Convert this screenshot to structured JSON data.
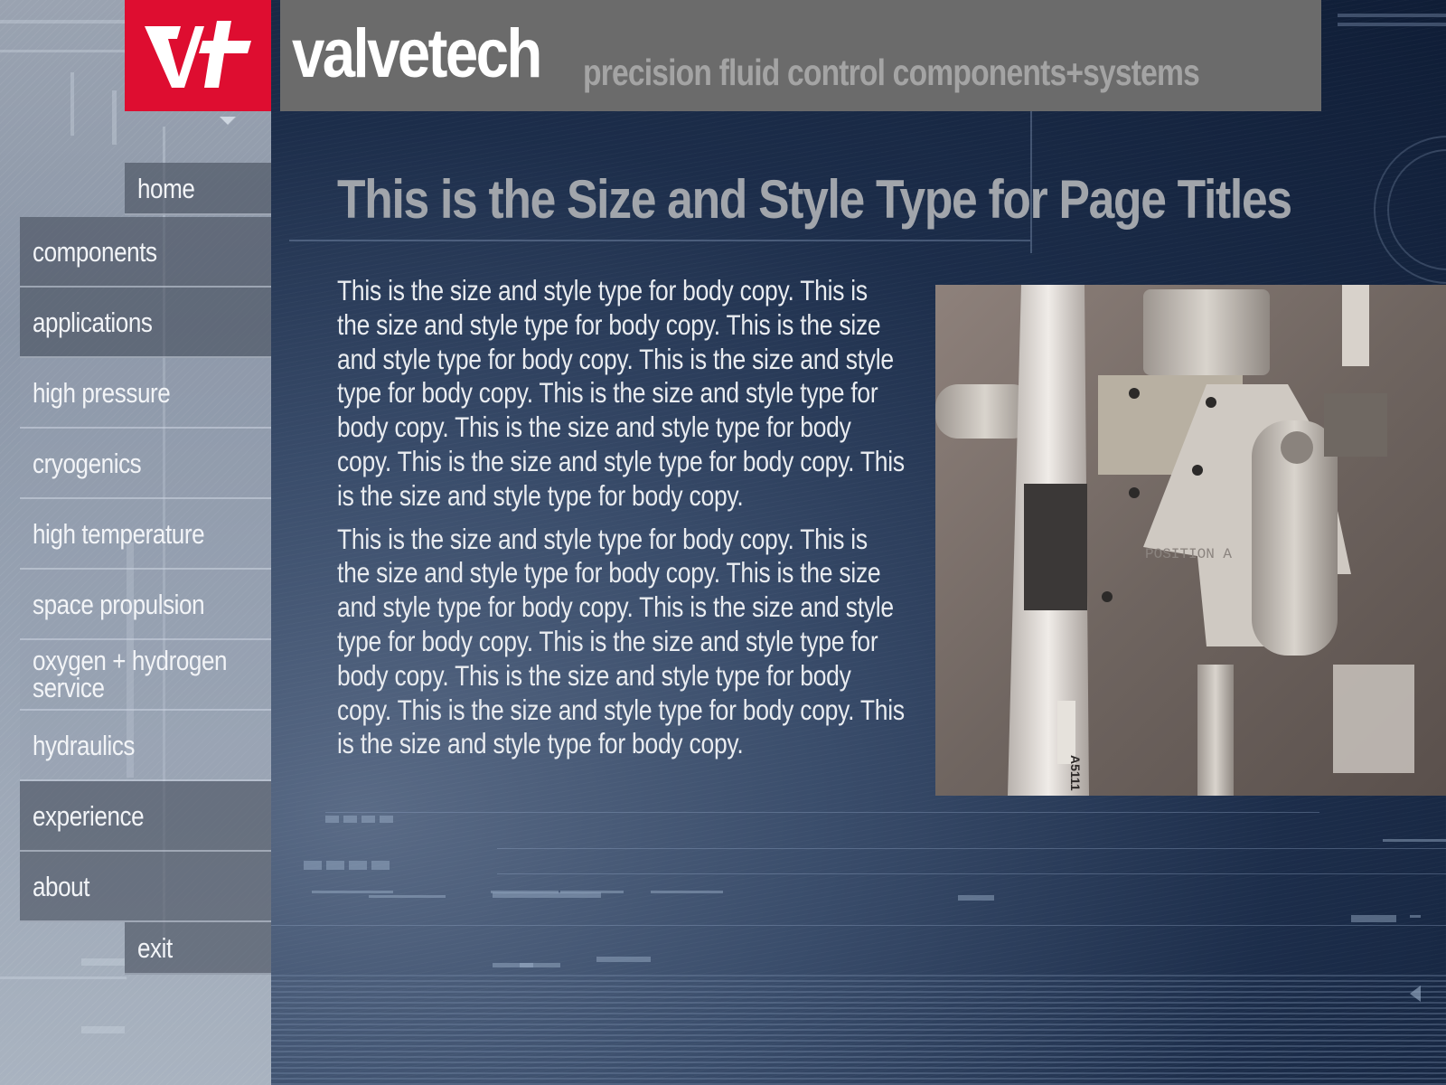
{
  "header": {
    "logo_text": "Vt",
    "brand_name": "valvetech",
    "tagline": "precision fluid control components+systems",
    "brand_color": "#de0d30",
    "header_bg": "#6b6b6b"
  },
  "nav": {
    "items": [
      {
        "label": "home",
        "style": "dark"
      },
      {
        "label": "components",
        "style": "dark"
      },
      {
        "label": "applications",
        "style": "dark"
      },
      {
        "label": "high pressure",
        "style": "light"
      },
      {
        "label": "cryogenics",
        "style": "light"
      },
      {
        "label": "high temperature",
        "style": "light"
      },
      {
        "label": "space propulsion",
        "style": "light"
      },
      {
        "label": "oxygen + hydrogen service",
        "style": "light"
      },
      {
        "label": "hydraulics",
        "style": "light"
      },
      {
        "label": "experience",
        "style": "dark"
      },
      {
        "label": "about",
        "style": "dark"
      },
      {
        "label": "exit",
        "style": "dark"
      }
    ]
  },
  "main": {
    "title": "This is the Size and Style Type for Page Titles",
    "paragraphs": [
      "This is the size and style type for body copy. This is the size and style type for body copy. This is the size and style type for body copy. This is the size and style type for body copy. This is the size and style type for body copy. This is the size and style type for body copy. This is the size and style type for body copy. This is the size and style type for body copy.",
      "This is the size and style type for body copy. This is the size and style type for body copy. This is the size and style type for body copy. This is the size and style type for body copy. This is the size and style type for body copy. This is the size and style type for body copy. This is the size and style type for body copy. This is the size and style type for body copy."
    ],
    "photo": {
      "description": "valve assembly photo",
      "labels": [
        "POSITION A",
        "A5111"
      ]
    }
  }
}
